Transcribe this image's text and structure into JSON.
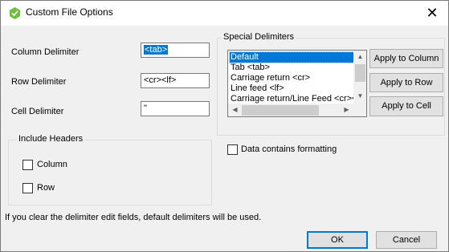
{
  "window": {
    "title": "Custom File Options",
    "app_icon": "green-hexagon-icon",
    "close_glyph": "✕"
  },
  "delimiters": {
    "column_label": "Column Delimiter",
    "column_value": "<tab>",
    "row_label": "Row Delimiter",
    "row_value": "<cr><lf>",
    "cell_label": "Cell Delimiter",
    "cell_value": "\""
  },
  "include_headers": {
    "title": "Include Headers",
    "column_label": "Column",
    "column_checked": false,
    "row_label": "Row",
    "row_checked": false
  },
  "special_delimiters": {
    "title": "Special Delimiters",
    "items": [
      {
        "label": "Default",
        "selected": true
      },
      {
        "label": "Tab <tab>",
        "selected": false
      },
      {
        "label": "Carriage return <cr>",
        "selected": false
      },
      {
        "label": "Line feed <lf>",
        "selected": false
      },
      {
        "label": "Carriage return/Line Feed <cr><lf>",
        "selected": false
      }
    ],
    "apply_column": "Apply to Column",
    "apply_row": "Apply to Row",
    "apply_cell": "Apply to Cell"
  },
  "formatting": {
    "label": "Data contains formatting",
    "checked": false
  },
  "footer": {
    "note": "If you clear the delimiter edit fields, default delimiters will be used.",
    "ok": "OK",
    "cancel": "Cancel"
  },
  "colors": {
    "selection": "#0078d7",
    "app_icon": "#6cbf3c"
  }
}
